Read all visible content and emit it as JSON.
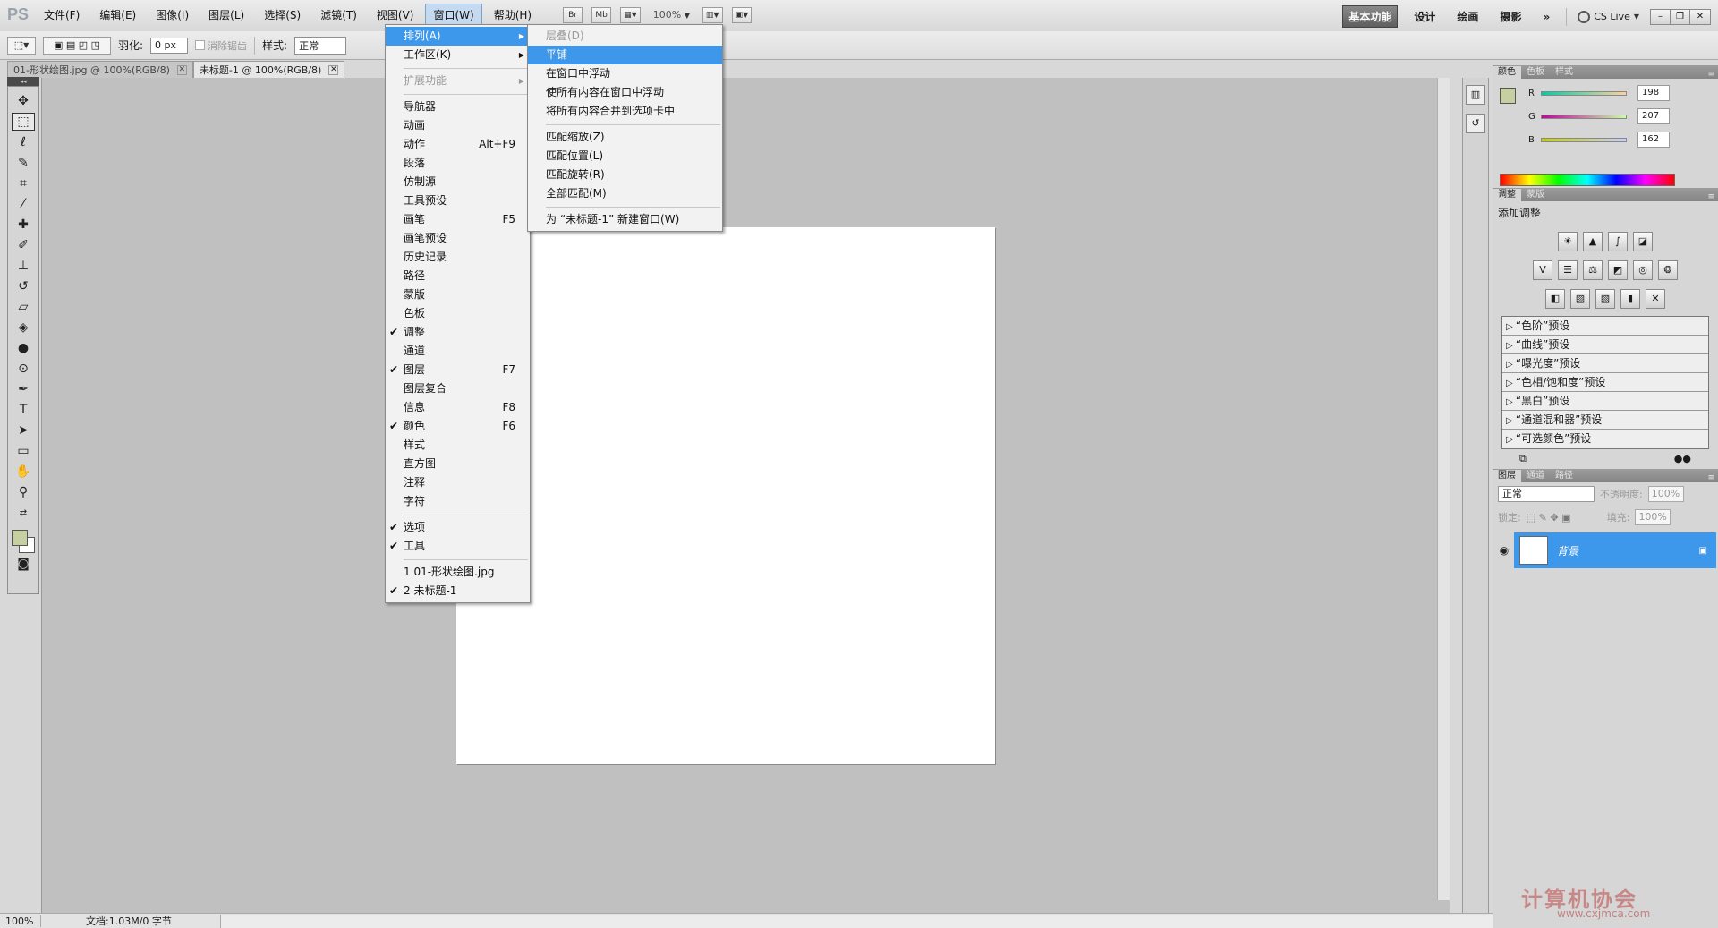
{
  "app": {
    "logo": "PS"
  },
  "menubar": {
    "items": [
      "文件(F)",
      "编辑(E)",
      "图像(I)",
      "图层(L)",
      "选择(S)",
      "滤镜(T)",
      "视图(V)",
      "窗口(W)",
      "帮助(H)"
    ],
    "active_index": 7,
    "bridge": "Br",
    "minibridge": "Mb",
    "zoom": "100%"
  },
  "workspace": {
    "buttons": [
      "基本功能",
      "设计",
      "绘画",
      "摄影"
    ],
    "more": "»",
    "cs_live": "CS Live"
  },
  "options": {
    "feather_label": "羽化:",
    "feather_value": "0 px",
    "antialias_label": "消除锯齿",
    "style_label": "样式:",
    "style_value": "正常"
  },
  "doc_tabs": [
    {
      "label": "01-形状绘图.jpg @ 100%(RGB/8)"
    },
    {
      "label": "未标题-1 @ 100%(RGB/8)"
    }
  ],
  "window_menu": {
    "items": [
      {
        "label": "排列(A)",
        "submenu": true,
        "highlight": true
      },
      {
        "label": "工作区(K)",
        "submenu": true
      },
      {
        "sep": true
      },
      {
        "label": "扩展功能",
        "submenu": true,
        "disabled": true
      },
      {
        "sep": true
      },
      {
        "label": "导航器"
      },
      {
        "label": "动画"
      },
      {
        "label": "动作",
        "shortcut": "Alt+F9"
      },
      {
        "label": "段落"
      },
      {
        "label": "仿制源"
      },
      {
        "label": "工具预设"
      },
      {
        "label": "画笔",
        "shortcut": "F5"
      },
      {
        "label": "画笔预设"
      },
      {
        "label": "历史记录"
      },
      {
        "label": "路径"
      },
      {
        "label": "蒙版"
      },
      {
        "label": "色板"
      },
      {
        "label": "调整",
        "checked": true
      },
      {
        "label": "通道"
      },
      {
        "label": "图层",
        "checked": true,
        "shortcut": "F7"
      },
      {
        "label": "图层复合"
      },
      {
        "label": "信息",
        "shortcut": "F8"
      },
      {
        "label": "颜色",
        "checked": true,
        "shortcut": "F6"
      },
      {
        "label": "样式"
      },
      {
        "label": "直方图"
      },
      {
        "label": "注释"
      },
      {
        "label": "字符"
      },
      {
        "sep": true
      },
      {
        "label": "选项",
        "checked": true
      },
      {
        "label": "工具",
        "checked": true
      },
      {
        "sep": true
      },
      {
        "label": "1 01-形状绘图.jpg"
      },
      {
        "label": "2 未标题-1",
        "checked": true
      }
    ]
  },
  "arrange_menu": {
    "items": [
      {
        "label": "层叠(D)",
        "disabled": true
      },
      {
        "label": "平铺",
        "highlight": true
      },
      {
        "label": "在窗口中浮动"
      },
      {
        "label": "使所有内容在窗口中浮动"
      },
      {
        "label": "将所有内容合并到选项卡中"
      },
      {
        "sep": true
      },
      {
        "label": "匹配缩放(Z)"
      },
      {
        "label": "匹配位置(L)"
      },
      {
        "label": "匹配旋转(R)"
      },
      {
        "label": "全部匹配(M)"
      },
      {
        "sep": true
      },
      {
        "label": "为 “未标题-1” 新建窗口(W)"
      }
    ]
  },
  "color_panel": {
    "tabs": [
      "颜色",
      "色板",
      "样式"
    ],
    "r": "198",
    "g": "207",
    "b": "162",
    "foreground": "#c6cfa2"
  },
  "adjustments_panel": {
    "tabs": [
      "调整",
      "蒙版"
    ],
    "title": "添加调整",
    "presets": [
      "“色阶”预设",
      "“曲线”预设",
      "“曝光度”预设",
      "“色相/饱和度”预设",
      "“黑白”预设",
      "“通道混和器”预设",
      "“可选颜色”预设"
    ]
  },
  "layers_panel": {
    "tabs": [
      "图层",
      "通道",
      "路径"
    ],
    "blend_mode": "正常",
    "opacity_label": "不透明度:",
    "opacity": "100%",
    "lock_label": "锁定:",
    "fill_label": "填充:",
    "fill": "100%",
    "layer_name": "背景"
  },
  "status": {
    "zoom": "100%",
    "doc_info": "文档:1.03M/0 字节"
  },
  "watermark": {
    "text": "计算机协会",
    "url": "www.cxjmca.com"
  },
  "colors": {
    "highlight": "#3d97ea",
    "canvas_bg": "#c0c0c0"
  }
}
